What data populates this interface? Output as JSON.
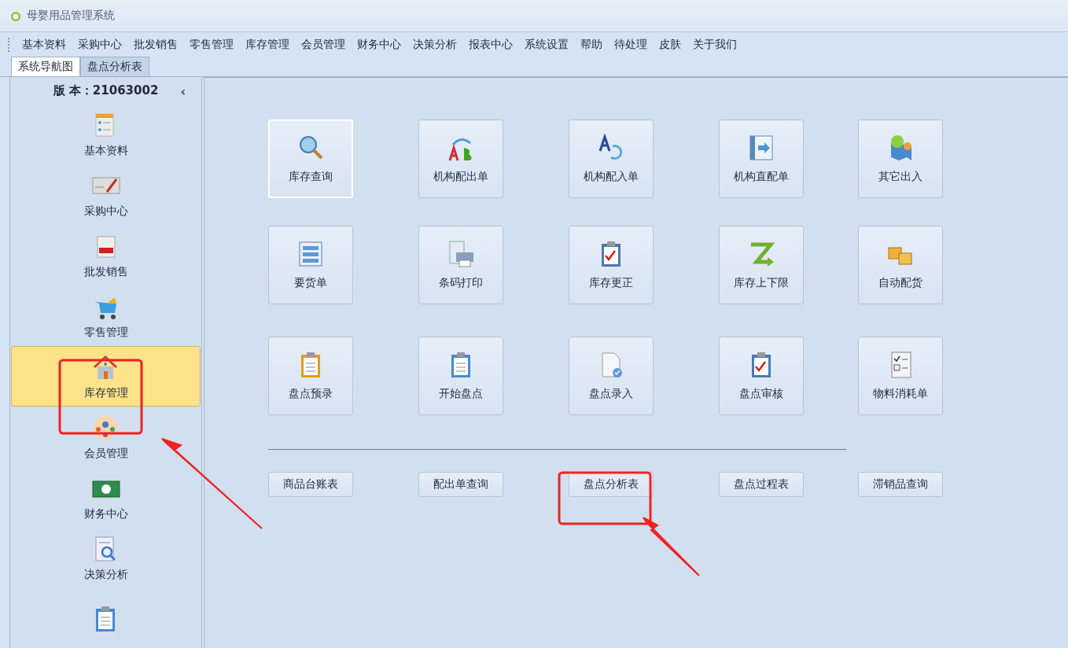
{
  "window": {
    "title": "母婴用品管理系统"
  },
  "menu": [
    "基本资料",
    "采购中心",
    "批发销售",
    "零售管理",
    "库存管理",
    "会员管理",
    "财务中心",
    "决策分析",
    "报表中心",
    "系统设置",
    "帮助",
    "待处理",
    "皮肤",
    "关于我们"
  ],
  "tabs": [
    {
      "label": "系统导航图",
      "selected": true
    },
    {
      "label": "盘点分析表",
      "selected": false
    }
  ],
  "sidebar": {
    "version": "版 本：21063002",
    "collapse": "‹",
    "items": [
      {
        "label": "基本资料",
        "selected": false
      },
      {
        "label": "采购中心",
        "selected": false
      },
      {
        "label": "批发销售",
        "selected": false
      },
      {
        "label": "零售管理",
        "selected": false
      },
      {
        "label": "库存管理",
        "selected": true
      },
      {
        "label": "会员管理",
        "selected": false
      },
      {
        "label": "财务中心",
        "selected": false
      },
      {
        "label": "决策分析",
        "selected": false
      }
    ]
  },
  "tiles": [
    {
      "label": "库存查询",
      "focused": true
    },
    {
      "label": "机构配出单",
      "focused": false
    },
    {
      "label": "机构配入单",
      "focused": false
    },
    {
      "label": "机构直配单",
      "focused": false
    },
    {
      "label": "其它出入",
      "focused": false
    },
    {
      "label": "要货单",
      "focused": false
    },
    {
      "label": "条码打印",
      "focused": false
    },
    {
      "label": "库存更正",
      "focused": false
    },
    {
      "label": "库存上下限",
      "focused": false
    },
    {
      "label": "自动配货",
      "focused": false
    },
    {
      "label": "盘点预录",
      "focused": false
    },
    {
      "label": "开始盘点",
      "focused": false
    },
    {
      "label": "盘点录入",
      "focused": false
    },
    {
      "label": "盘点审核",
      "focused": false
    },
    {
      "label": "物料消耗单",
      "focused": false
    }
  ],
  "reports": [
    "商品台账表",
    "配出单查询",
    "盘点分析表",
    "盘点过程表",
    "滞销品查询"
  ]
}
